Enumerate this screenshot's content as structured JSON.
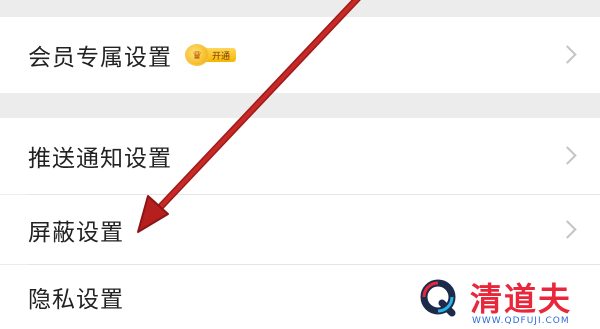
{
  "settings": {
    "items": [
      {
        "label": "会员专属设置",
        "badge": "开通"
      },
      {
        "label": "推送通知设置"
      },
      {
        "label": "屏蔽设置"
      },
      {
        "label": "隐私设置"
      }
    ]
  },
  "annotation": {
    "arrow_color": "#b5201f"
  },
  "watermark": {
    "title": "清道夫",
    "url": "WWW.QDFUJI.COM",
    "accent": "#e8273b"
  }
}
